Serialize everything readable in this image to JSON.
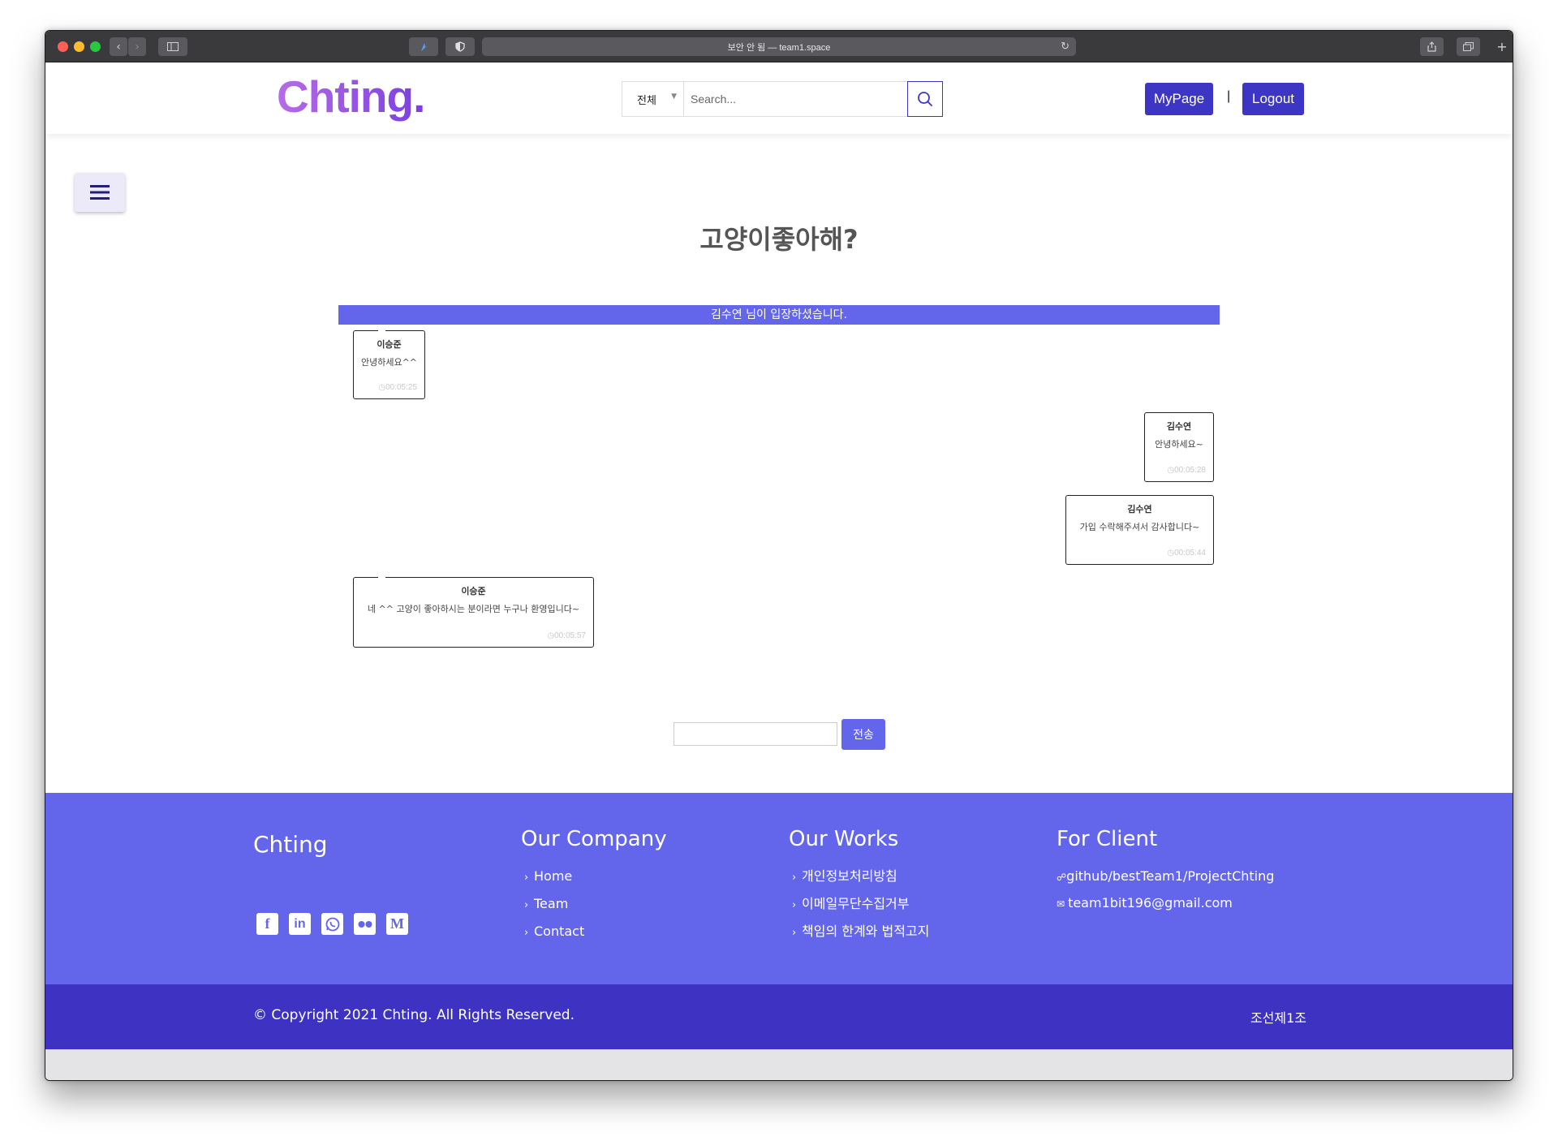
{
  "browser": {
    "address": "보안 안 됨 — team1.space"
  },
  "header": {
    "logo": "Chting.",
    "search_category": "전체",
    "search_placeholder": "Search...",
    "mypage_label": "MyPage",
    "separator": "|",
    "logout_label": "Logout"
  },
  "room": {
    "title": "고양이좋아해?",
    "notice": "김수연 님이 입장하셨습니다."
  },
  "messages": [
    {
      "name": "이승준",
      "text": "안녕하세요^^",
      "time": "00:05:25",
      "side": "left"
    },
    {
      "name": "김수연",
      "text": "안녕하세요~",
      "time": "00:05:28",
      "side": "right"
    },
    {
      "name": "김수연",
      "text": "가입 수락해주셔서 감사합니다~",
      "time": "00:05:44",
      "side": "right"
    },
    {
      "name": "이승준",
      "text": "네 ^^ 고양이 좋아하시는 분이라면 누구나 환영입니다~",
      "time": "00:05:57",
      "side": "left"
    }
  ],
  "chat": {
    "input_value": "",
    "send_label": "전송"
  },
  "footer": {
    "brand": "Chting",
    "company_title": "Our Company",
    "company_links": [
      "Home",
      "Team",
      "Contact"
    ],
    "works_title": "Our Works",
    "works_links": [
      "개인정보처리방침",
      "이메일무단수집거부",
      "책임의 한계와 법적고지"
    ],
    "client_title": "For Client",
    "client_github": "github/bestTeam1/ProjectChting",
    "client_email": "team1bit196@gmail.com",
    "social_icons": [
      "facebook-icon",
      "linkedin-icon",
      "whatsapp-icon",
      "flickr-icon",
      "medium-icon"
    ],
    "copyright": "© Copyright 2021 Chting. All Rights Reserved.",
    "team": "조선제1조"
  },
  "colors": {
    "primary": "#6366ea",
    "dark": "#3d32c2",
    "logo_gradient_start": "#b56ce8",
    "logo_gradient_end": "#7b3fe0"
  }
}
